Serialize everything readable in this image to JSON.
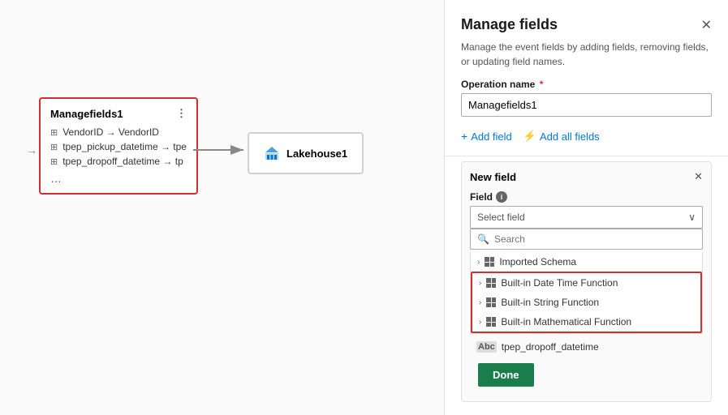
{
  "panel": {
    "title": "Manage fields",
    "description": "Manage the event fields by adding fields, removing fields, or updating field names.",
    "operation_label": "Operation name",
    "operation_value": "Managefields1",
    "add_field_label": "Add field",
    "add_all_label": "Add all fields"
  },
  "new_field": {
    "title": "New field",
    "field_label": "Field",
    "select_placeholder": "Select field",
    "search_placeholder": "Search"
  },
  "dropdown_items": [
    {
      "label": "Imported Schema",
      "highlighted": false
    },
    {
      "label": "Built-in Date Time Function",
      "highlighted": true
    },
    {
      "label": "Built-in String Function",
      "highlighted": true
    },
    {
      "label": "Built-in Mathematical Function",
      "highlighted": true
    }
  ],
  "footer_item": "tpep_dropoff_datetime",
  "done_label": "Done",
  "canvas": {
    "manage_node": {
      "title": "Managefields1",
      "fields": [
        "VendorID → VendorID",
        "tpep_pickup_datetime → tpe",
        "tpep_dropoff_datetime → tp"
      ]
    },
    "lakehouse_node": {
      "title": "Lakehouse1"
    }
  }
}
